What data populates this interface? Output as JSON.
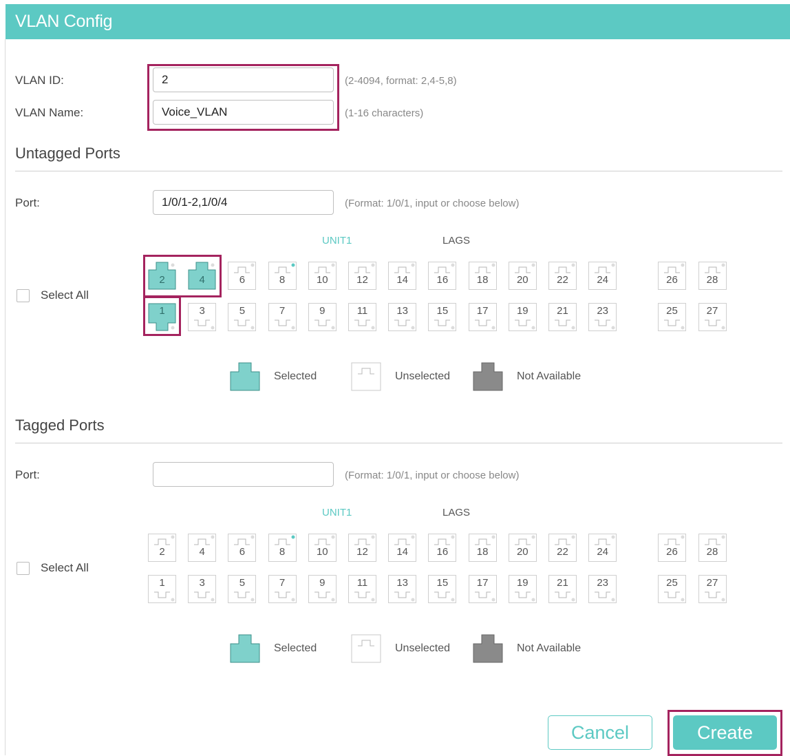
{
  "window": {
    "title": "VLAN Config"
  },
  "vlan": {
    "id_label": "VLAN ID:",
    "id_value": "2",
    "id_hint": "(2-4094, format: 2,4-5,8)",
    "name_label": "VLAN Name:",
    "name_value": "Voice_VLAN",
    "name_hint": "(1-16 characters)"
  },
  "untagged": {
    "title": "Untagged Ports",
    "port_label": "Port:",
    "port_value": "1/0/1-2,1/0/4",
    "port_hint": "(Format: 1/0/1, input or choose below)",
    "unit_label": "UNIT1",
    "lags_label": "LAGS",
    "select_all": "Select All",
    "selected_ports": [
      "1",
      "2",
      "4"
    ]
  },
  "tagged": {
    "title": "Tagged Ports",
    "port_label": "Port:",
    "port_value": "",
    "port_hint": "(Format: 1/0/1, input or choose below)",
    "unit_label": "UNIT1",
    "lags_label": "LAGS",
    "select_all": "Select All",
    "selected_ports": []
  },
  "ports": {
    "unit_top": [
      "2",
      "4",
      "6",
      "8",
      "10",
      "12",
      "14",
      "16",
      "18",
      "20",
      "22",
      "24"
    ],
    "unit_bottom": [
      "1",
      "3",
      "5",
      "7",
      "9",
      "11",
      "13",
      "15",
      "17",
      "19",
      "21",
      "23"
    ],
    "lags_top": [
      "26",
      "28"
    ],
    "lags_bottom": [
      "25",
      "27"
    ],
    "link_up": [
      "8"
    ]
  },
  "legend": {
    "selected": "Selected",
    "unselected": "Unselected",
    "not_available": "Not Available"
  },
  "colors": {
    "accent": "#5cc9c3",
    "highlight": "#a4235e",
    "selected_fill": "#7fd1cb",
    "not_available_fill": "#8a8a8a",
    "link_dot": "#5cc9c3"
  },
  "buttons": {
    "cancel": "Cancel",
    "create": "Create"
  }
}
